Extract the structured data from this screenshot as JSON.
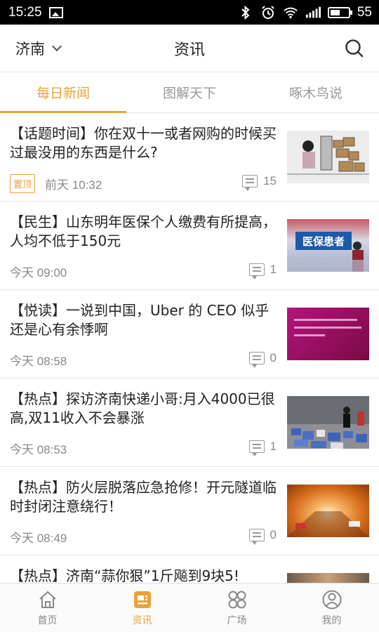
{
  "status_bar": {
    "time": "15:25",
    "battery": "55",
    "battery_level": 0.55
  },
  "header": {
    "city": "济南",
    "title": "资讯"
  },
  "tabs": [
    {
      "label": "每日新闻",
      "active": true
    },
    {
      "label": "图解天下",
      "active": false
    },
    {
      "label": "啄木鸟说",
      "active": false
    }
  ],
  "news": [
    {
      "title": "【话题时间】你在双十一或者网购的时候买过最没用的东西是什么?",
      "badge": "置顶",
      "time": "前天 10:32",
      "comments": "15"
    },
    {
      "title": "【民生】山东明年医保个人缴费有所提高，人均不低于150元",
      "time": "今天 09:00",
      "comments": "1",
      "thumb_text": "医保患者"
    },
    {
      "title": "【悦读】一说到中国，Uber 的 CEO 似乎还是心有余悸啊",
      "time": "今天 08:58",
      "comments": "0"
    },
    {
      "title": "【热点】探访济南快递小哥:月入4000已很高,双11收入不会暴涨",
      "time": "今天 08:53",
      "comments": "1"
    },
    {
      "title": "【热点】防火层脱落应急抢修！开元隧道临时封闭注意绕行！",
      "time": "今天 08:49",
      "comments": "0"
    },
    {
      "title": "【热点】济南“蒜你狠”1斤飚到9块5!"
    }
  ],
  "bottom_nav": [
    {
      "label": "首页",
      "icon": "home-icon",
      "active": false
    },
    {
      "label": "资讯",
      "icon": "news-icon",
      "active": true
    },
    {
      "label": "广场",
      "icon": "square-icon",
      "active": false
    },
    {
      "label": "我的",
      "icon": "profile-icon",
      "active": false
    }
  ],
  "colors": {
    "accent": "#e8a23a"
  }
}
